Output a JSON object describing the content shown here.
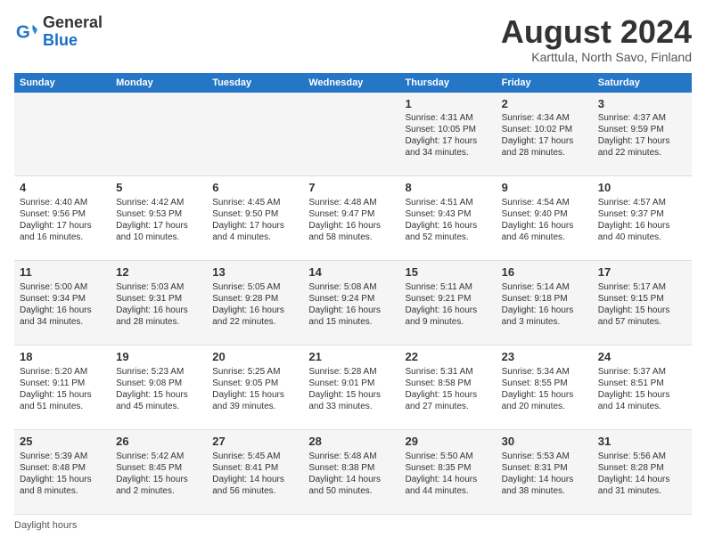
{
  "logo": {
    "line1": "General",
    "line2": "Blue"
  },
  "title": "August 2024",
  "subtitle": "Karttula, North Savo, Finland",
  "days_of_week": [
    "Sunday",
    "Monday",
    "Tuesday",
    "Wednesday",
    "Thursday",
    "Friday",
    "Saturday"
  ],
  "footer_label": "Daylight hours",
  "weeks": [
    [
      {
        "num": "",
        "info": ""
      },
      {
        "num": "",
        "info": ""
      },
      {
        "num": "",
        "info": ""
      },
      {
        "num": "",
        "info": ""
      },
      {
        "num": "1",
        "info": "Sunrise: 4:31 AM\nSunset: 10:05 PM\nDaylight: 17 hours\nand 34 minutes."
      },
      {
        "num": "2",
        "info": "Sunrise: 4:34 AM\nSunset: 10:02 PM\nDaylight: 17 hours\nand 28 minutes."
      },
      {
        "num": "3",
        "info": "Sunrise: 4:37 AM\nSunset: 9:59 PM\nDaylight: 17 hours\nand 22 minutes."
      }
    ],
    [
      {
        "num": "4",
        "info": "Sunrise: 4:40 AM\nSunset: 9:56 PM\nDaylight: 17 hours\nand 16 minutes."
      },
      {
        "num": "5",
        "info": "Sunrise: 4:42 AM\nSunset: 9:53 PM\nDaylight: 17 hours\nand 10 minutes."
      },
      {
        "num": "6",
        "info": "Sunrise: 4:45 AM\nSunset: 9:50 PM\nDaylight: 17 hours\nand 4 minutes."
      },
      {
        "num": "7",
        "info": "Sunrise: 4:48 AM\nSunset: 9:47 PM\nDaylight: 16 hours\nand 58 minutes."
      },
      {
        "num": "8",
        "info": "Sunrise: 4:51 AM\nSunset: 9:43 PM\nDaylight: 16 hours\nand 52 minutes."
      },
      {
        "num": "9",
        "info": "Sunrise: 4:54 AM\nSunset: 9:40 PM\nDaylight: 16 hours\nand 46 minutes."
      },
      {
        "num": "10",
        "info": "Sunrise: 4:57 AM\nSunset: 9:37 PM\nDaylight: 16 hours\nand 40 minutes."
      }
    ],
    [
      {
        "num": "11",
        "info": "Sunrise: 5:00 AM\nSunset: 9:34 PM\nDaylight: 16 hours\nand 34 minutes."
      },
      {
        "num": "12",
        "info": "Sunrise: 5:03 AM\nSunset: 9:31 PM\nDaylight: 16 hours\nand 28 minutes."
      },
      {
        "num": "13",
        "info": "Sunrise: 5:05 AM\nSunset: 9:28 PM\nDaylight: 16 hours\nand 22 minutes."
      },
      {
        "num": "14",
        "info": "Sunrise: 5:08 AM\nSunset: 9:24 PM\nDaylight: 16 hours\nand 15 minutes."
      },
      {
        "num": "15",
        "info": "Sunrise: 5:11 AM\nSunset: 9:21 PM\nDaylight: 16 hours\nand 9 minutes."
      },
      {
        "num": "16",
        "info": "Sunrise: 5:14 AM\nSunset: 9:18 PM\nDaylight: 16 hours\nand 3 minutes."
      },
      {
        "num": "17",
        "info": "Sunrise: 5:17 AM\nSunset: 9:15 PM\nDaylight: 15 hours\nand 57 minutes."
      }
    ],
    [
      {
        "num": "18",
        "info": "Sunrise: 5:20 AM\nSunset: 9:11 PM\nDaylight: 15 hours\nand 51 minutes."
      },
      {
        "num": "19",
        "info": "Sunrise: 5:23 AM\nSunset: 9:08 PM\nDaylight: 15 hours\nand 45 minutes."
      },
      {
        "num": "20",
        "info": "Sunrise: 5:25 AM\nSunset: 9:05 PM\nDaylight: 15 hours\nand 39 minutes."
      },
      {
        "num": "21",
        "info": "Sunrise: 5:28 AM\nSunset: 9:01 PM\nDaylight: 15 hours\nand 33 minutes."
      },
      {
        "num": "22",
        "info": "Sunrise: 5:31 AM\nSunset: 8:58 PM\nDaylight: 15 hours\nand 27 minutes."
      },
      {
        "num": "23",
        "info": "Sunrise: 5:34 AM\nSunset: 8:55 PM\nDaylight: 15 hours\nand 20 minutes."
      },
      {
        "num": "24",
        "info": "Sunrise: 5:37 AM\nSunset: 8:51 PM\nDaylight: 15 hours\nand 14 minutes."
      }
    ],
    [
      {
        "num": "25",
        "info": "Sunrise: 5:39 AM\nSunset: 8:48 PM\nDaylight: 15 hours\nand 8 minutes."
      },
      {
        "num": "26",
        "info": "Sunrise: 5:42 AM\nSunset: 8:45 PM\nDaylight: 15 hours\nand 2 minutes."
      },
      {
        "num": "27",
        "info": "Sunrise: 5:45 AM\nSunset: 8:41 PM\nDaylight: 14 hours\nand 56 minutes."
      },
      {
        "num": "28",
        "info": "Sunrise: 5:48 AM\nSunset: 8:38 PM\nDaylight: 14 hours\nand 50 minutes."
      },
      {
        "num": "29",
        "info": "Sunrise: 5:50 AM\nSunset: 8:35 PM\nDaylight: 14 hours\nand 44 minutes."
      },
      {
        "num": "30",
        "info": "Sunrise: 5:53 AM\nSunset: 8:31 PM\nDaylight: 14 hours\nand 38 minutes."
      },
      {
        "num": "31",
        "info": "Sunrise: 5:56 AM\nSunset: 8:28 PM\nDaylight: 14 hours\nand 31 minutes."
      }
    ]
  ]
}
